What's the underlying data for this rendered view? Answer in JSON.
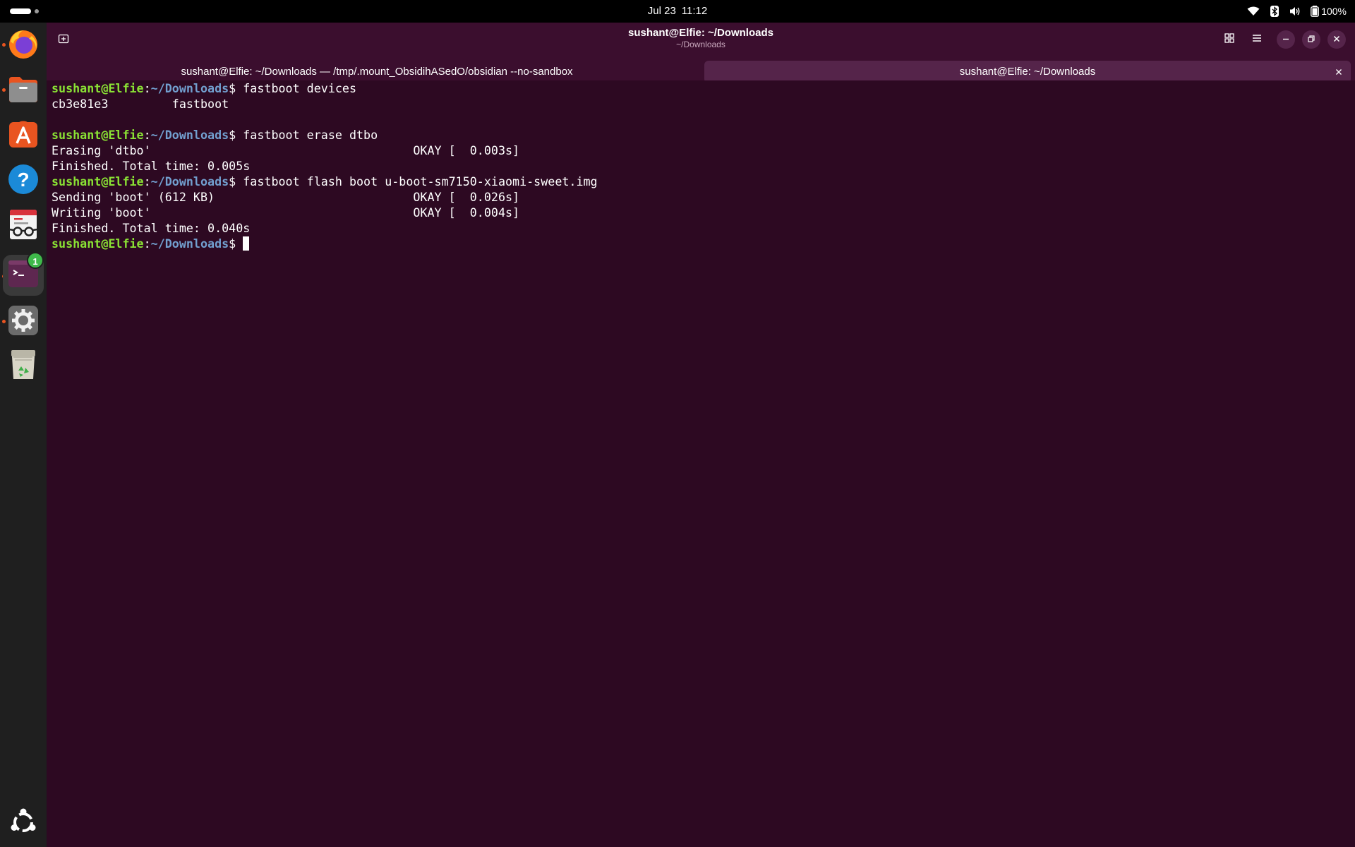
{
  "topbar": {
    "date": "Jul 23",
    "time": "11:12",
    "battery": "100%",
    "tray_icons": [
      "wifi-icon",
      "bluetooth-icon",
      "volume-icon",
      "battery-icon"
    ]
  },
  "dock": {
    "items": [
      {
        "name": "firefox",
        "icon": "firefox-icon",
        "running": true
      },
      {
        "name": "files",
        "icon": "files-icon",
        "running": true
      },
      {
        "name": "app-center",
        "icon": "app-center-icon",
        "running": false
      },
      {
        "name": "help",
        "icon": "help-icon",
        "running": false
      },
      {
        "name": "document-viewer",
        "icon": "document-viewer-icon",
        "running": false
      },
      {
        "name": "terminal",
        "icon": "terminal-icon",
        "running": true,
        "badge": "1"
      },
      {
        "name": "settings",
        "icon": "settings-icon",
        "running": true
      },
      {
        "name": "trash",
        "icon": "trash-icon",
        "running": false
      }
    ],
    "show_apps_icon": "ubuntu-logo-icon"
  },
  "window": {
    "title": "sushant@Elfie: ~/Downloads",
    "subtitle": "~/Downloads",
    "tabs": [
      {
        "label": "sushant@Elfie: ~/Downloads — /tmp/.mount_ObsidihASedO/obsidian --no-sandbox",
        "active": false
      },
      {
        "label": "sushant@Elfie: ~/Downloads",
        "active": true
      }
    ]
  },
  "terminal": {
    "user_host": "sushant@Elfie",
    "path": "~/Downloads",
    "lines": [
      {
        "kind": "prompt",
        "cmd": "fastboot devices"
      },
      {
        "kind": "out",
        "text": "cb3e81e3         fastboot"
      },
      {
        "kind": "out",
        "text": ""
      },
      {
        "kind": "prompt",
        "cmd": "fastboot erase dtbo"
      },
      {
        "kind": "out",
        "text": "Erasing 'dtbo'                                     OKAY [  0.003s]"
      },
      {
        "kind": "out",
        "text": "Finished. Total time: 0.005s"
      },
      {
        "kind": "prompt",
        "cmd": "fastboot flash boot u-boot-sm7150-xiaomi-sweet.img"
      },
      {
        "kind": "out",
        "text": "Sending 'boot' (612 KB)                            OKAY [  0.026s]"
      },
      {
        "kind": "out",
        "text": "Writing 'boot'                                     OKAY [  0.004s]"
      },
      {
        "kind": "out",
        "text": "Finished. Total time: 0.040s"
      },
      {
        "kind": "prompt",
        "cmd": "",
        "cursor": true
      }
    ]
  }
}
